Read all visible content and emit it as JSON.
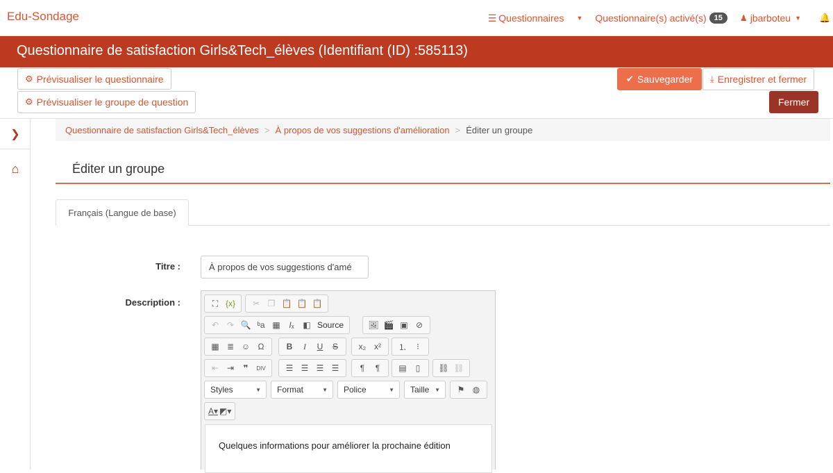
{
  "app": {
    "brand": "Edu-Sondage"
  },
  "nav": {
    "questionnaires": "Questionnaires",
    "active": "Questionnaire(s) activé(s)",
    "active_count": "15",
    "user": "jbarboteu"
  },
  "title": "Questionnaire de satisfaction Girls&Tech_élèves (Identifiant (ID) :585113)",
  "actions": {
    "preview_survey": "Prévisualiser le questionnaire",
    "preview_group": "Prévisualiser le groupe de question",
    "save": "Sauvegarder",
    "save_close": "Enregistrer et fermer",
    "close": "Fermer"
  },
  "breadcrumb": {
    "survey": "Questionnaire de satisfaction Girls&Tech_élèves",
    "group": "À propos de vos suggestions d'amélioration",
    "current": "Éditer un groupe"
  },
  "page_title": "Éditer un groupe",
  "tab": "Français (Langue de base)",
  "form": {
    "title_label": "Titre :",
    "title_value": "À propos de vos suggestions d'amé",
    "description_label": "Description :"
  },
  "editor": {
    "source": "Source",
    "styles": "Styles",
    "format": "Format",
    "font": "Police",
    "size": "Taille",
    "content": "Quelques informations pour améliorer la prochaine édition"
  },
  "colors": {
    "accent": "#d8552f",
    "titlebar": "#bc3a1f",
    "save": "#ec6e4b",
    "close": "#9a3426"
  }
}
